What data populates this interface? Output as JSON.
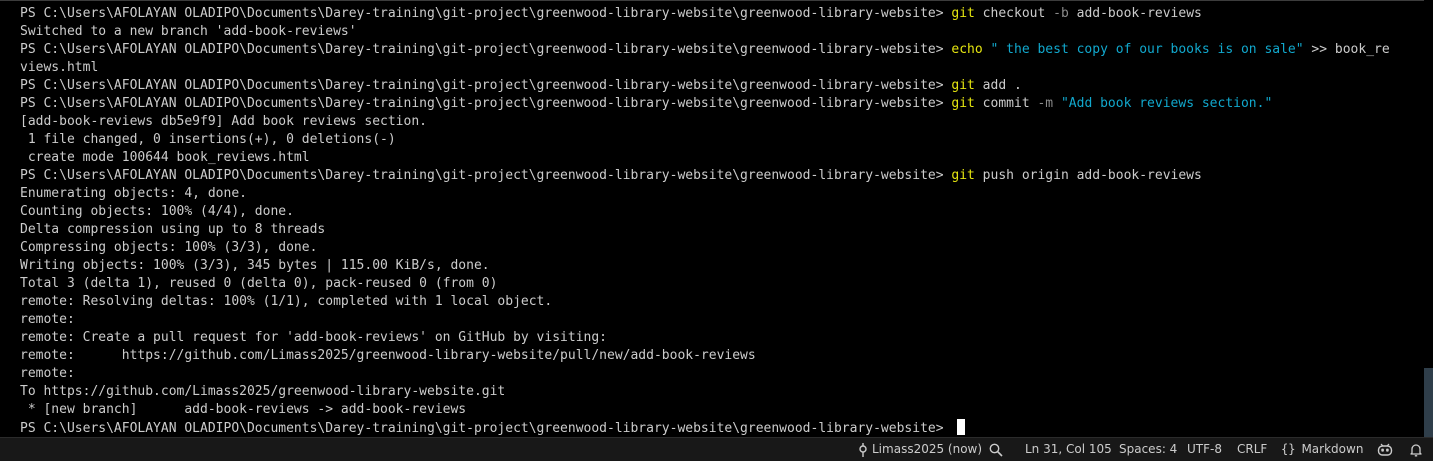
{
  "terminal": {
    "prompt": "PS C:\\Users\\AFOLAYAN OLADIPO\\Documents\\Darey-training\\git-project\\greenwood-library-website\\greenwood-library-website> ",
    "lines": [
      {
        "parts": [
          {
            "style": "",
            "text": "PS C:\\Users\\AFOLAYAN OLADIPO\\Documents\\Darey-training\\git-project\\greenwood-library-website\\greenwood-library-website> "
          },
          {
            "style": "t-yellow",
            "text": "git"
          },
          {
            "style": "",
            "text": " checkout "
          },
          {
            "style": "t-gray",
            "text": "-b"
          },
          {
            "style": "",
            "text": " add-book-reviews"
          }
        ]
      },
      {
        "parts": [
          {
            "style": "",
            "text": "Switched to a new branch 'add-book-reviews'"
          }
        ]
      },
      {
        "parts": [
          {
            "style": "",
            "text": "PS C:\\Users\\AFOLAYAN OLADIPO\\Documents\\Darey-training\\git-project\\greenwood-library-website\\greenwood-library-website> "
          },
          {
            "style": "t-yellow",
            "text": "echo"
          },
          {
            "style": "",
            "text": " "
          },
          {
            "style": "t-cyan",
            "text": "\" the best copy of our books is on sale\""
          },
          {
            "style": "",
            "text": " >> book_re"
          }
        ]
      },
      {
        "parts": [
          {
            "style": "",
            "text": "views.html"
          }
        ]
      },
      {
        "parts": [
          {
            "style": "",
            "text": "PS C:\\Users\\AFOLAYAN OLADIPO\\Documents\\Darey-training\\git-project\\greenwood-library-website\\greenwood-library-website> "
          },
          {
            "style": "t-yellow",
            "text": "git"
          },
          {
            "style": "",
            "text": " add ."
          }
        ]
      },
      {
        "parts": [
          {
            "style": "",
            "text": "PS C:\\Users\\AFOLAYAN OLADIPO\\Documents\\Darey-training\\git-project\\greenwood-library-website\\greenwood-library-website> "
          },
          {
            "style": "t-yellow",
            "text": "git"
          },
          {
            "style": "",
            "text": " commit "
          },
          {
            "style": "t-gray",
            "text": "-m"
          },
          {
            "style": "",
            "text": " "
          },
          {
            "style": "t-cyan",
            "text": "\"Add book reviews section.\""
          }
        ]
      },
      {
        "parts": [
          {
            "style": "",
            "text": "[add-book-reviews db5e9f9] Add book reviews section."
          }
        ]
      },
      {
        "parts": [
          {
            "style": "",
            "text": " 1 file changed, 0 insertions(+), 0 deletions(-)"
          }
        ]
      },
      {
        "parts": [
          {
            "style": "",
            "text": " create mode 100644 book_reviews.html"
          }
        ]
      },
      {
        "parts": [
          {
            "style": "",
            "text": "PS C:\\Users\\AFOLAYAN OLADIPO\\Documents\\Darey-training\\git-project\\greenwood-library-website\\greenwood-library-website> "
          },
          {
            "style": "t-yellow",
            "text": "git"
          },
          {
            "style": "",
            "text": " push origin add-book-reviews"
          }
        ]
      },
      {
        "parts": [
          {
            "style": "",
            "text": "Enumerating objects: 4, done."
          }
        ]
      },
      {
        "parts": [
          {
            "style": "",
            "text": "Counting objects: 100% (4/4), done."
          }
        ]
      },
      {
        "parts": [
          {
            "style": "",
            "text": "Delta compression using up to 8 threads"
          }
        ]
      },
      {
        "parts": [
          {
            "style": "",
            "text": "Compressing objects: 100% (3/3), done."
          }
        ]
      },
      {
        "parts": [
          {
            "style": "",
            "text": "Writing objects: 100% (3/3), 345 bytes | 115.00 KiB/s, done."
          }
        ]
      },
      {
        "parts": [
          {
            "style": "",
            "text": "Total 3 (delta 1), reused 0 (delta 0), pack-reused 0 (from 0)"
          }
        ]
      },
      {
        "parts": [
          {
            "style": "",
            "text": "remote: Resolving deltas: 100% (1/1), completed with 1 local object."
          }
        ]
      },
      {
        "parts": [
          {
            "style": "",
            "text": "remote:"
          }
        ]
      },
      {
        "parts": [
          {
            "style": "",
            "text": "remote: Create a pull request for 'add-book-reviews' on GitHub by visiting:"
          }
        ]
      },
      {
        "parts": [
          {
            "style": "",
            "text": "remote:      https://github.com/Limass2025/greenwood-library-website/pull/new/add-book-reviews"
          }
        ]
      },
      {
        "parts": [
          {
            "style": "",
            "text": "remote:"
          }
        ]
      },
      {
        "parts": [
          {
            "style": "",
            "text": "To https://github.com/Limass2025/greenwood-library-website.git"
          }
        ]
      },
      {
        "parts": [
          {
            "style": "",
            "text": " * [new branch]      add-book-reviews -> add-book-reviews"
          }
        ]
      }
    ]
  },
  "statusbar": {
    "git_user": "Limass2025 (now)",
    "cursor_position": "Ln 31, Col 105",
    "indentation": "Spaces: 4",
    "encoding": "UTF-8",
    "line_ending": "CRLF",
    "language": "Markdown",
    "icons": {
      "git_user": "git-commit-icon",
      "zoom": "zoom-icon",
      "language": "braces-icon",
      "copilot": "copilot-icon",
      "notifications": "bell-icon"
    }
  },
  "colors": {
    "background": "#000000",
    "text": "#cccccc",
    "command": "#e5e510",
    "flag": "#8b8b8b",
    "string": "#11a8cd",
    "statusbar": "#181818"
  }
}
